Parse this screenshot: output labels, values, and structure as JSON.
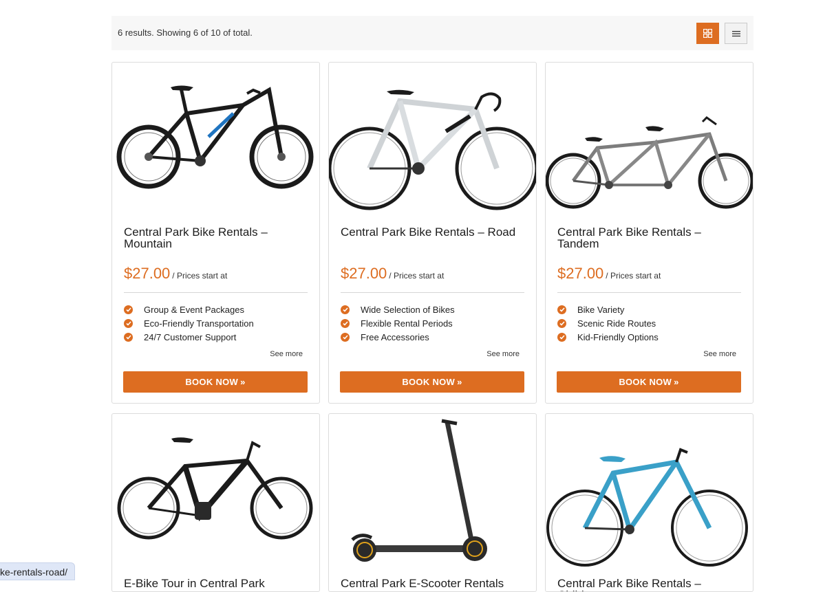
{
  "toolbar": {
    "results_text": "6 results. Showing 6 of 10 of total.",
    "grid_view_icon": "grid-icon",
    "list_view_icon": "list-icon"
  },
  "cards": [
    {
      "title": "Central Park Bike Rentals – Mountain",
      "price": "$27.00",
      "price_note": "/ Prices start at",
      "features": [
        "Group & Event Packages",
        "Eco-Friendly Transportation",
        "24/7 Customer Support"
      ],
      "see_more": "See more",
      "book_label": "BOOK NOW",
      "image": "mountain-bike"
    },
    {
      "title": "Central Park Bike Rentals – Road",
      "price": "$27.00",
      "price_note": "/ Prices start at",
      "features": [
        "Wide Selection of Bikes",
        "Flexible Rental Periods",
        "Free Accessories"
      ],
      "see_more": "See more",
      "book_label": "BOOK NOW",
      "image": "road-bike"
    },
    {
      "title": "Central Park Bike Rentals – Tandem",
      "price": "$27.00",
      "price_note": "/ Prices start at",
      "features": [
        "Bike Variety",
        "Scenic Ride Routes",
        "Kid-Friendly Options"
      ],
      "see_more": "See more",
      "book_label": "BOOK NOW",
      "image": "tandem-bike"
    },
    {
      "title": "E-Bike Tour in Central Park",
      "image": "e-bike"
    },
    {
      "title": "Central Park E-Scooter Rentals",
      "image": "e-scooter"
    },
    {
      "title": "Central Park Bike Rentals – Children",
      "image": "kids-bike"
    }
  ],
  "status_bar": {
    "url": "ke-rentals-road/"
  },
  "colors": {
    "accent": "#dd6d21",
    "toolbar_bg": "#f7f7f7",
    "bike_teal": "#3aa0c8"
  }
}
